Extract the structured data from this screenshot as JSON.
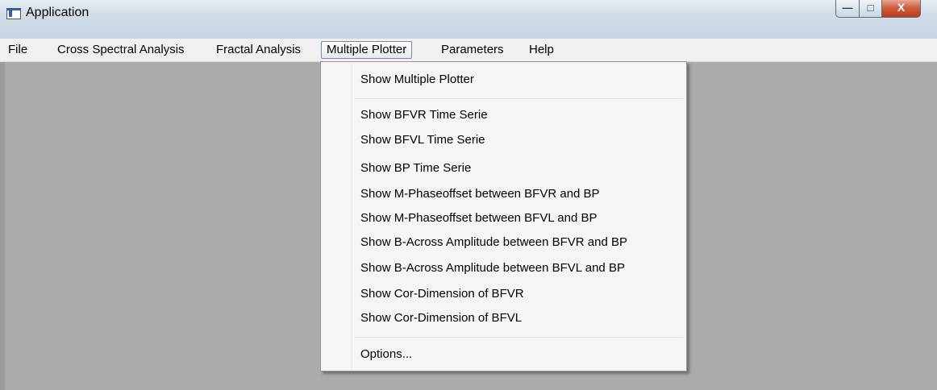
{
  "window": {
    "title": "Application",
    "minimize_glyph": "—",
    "maximize_glyph": "□",
    "close_glyph": "X"
  },
  "menubar": {
    "items": [
      "File",
      "Cross Spectral Analysis",
      "Fractal Analysis",
      "Multiple Plotter",
      "Parameters",
      "Help"
    ],
    "active": "Multiple Plotter"
  },
  "dropdown": {
    "group1": [
      "Show Multiple Plotter"
    ],
    "group2": [
      "Show BFVR Time Serie",
      "Show BFVL Time Serie",
      "Show BP Time Serie",
      "Show M-Phaseoffset between BFVR and BP",
      "Show M-Phaseoffset between BFVL and BP",
      "Show B-Across Amplitude between BFVR and BP",
      "Show B-Across Amplitude between BFVL and BP",
      "Show Cor-Dimension of BFVR",
      "Show Cor-Dimension of BFVL"
    ],
    "group3": [
      "Options..."
    ]
  },
  "colors": {
    "client_background": "#ababab",
    "menubar_background": "#f0f0f0",
    "dropdown_background": "#f5f5f5",
    "close_button": "#c9472a"
  }
}
